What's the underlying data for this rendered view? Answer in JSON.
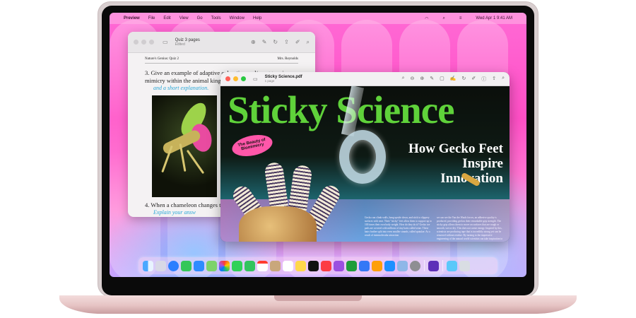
{
  "menubar": {
    "items": [
      "Preview",
      "File",
      "Edit",
      "View",
      "Go",
      "Tools",
      "Window",
      "Help"
    ],
    "clock": "Wed Apr 1  9:41 AM"
  },
  "window_quiz": {
    "title": "Quiz 3 pages",
    "subtitle": "Edited",
    "header_left": "Nature's Genius: Quiz 2",
    "header_right": "Mrs. Reynolds",
    "q3": "3. Give an example of adaptive coloration and/or aggressive mimicry within the animal king",
    "q3_hand": "and a short explanation.",
    "q4": "4. When a chameleon changes that an example of",
    "q4_hand": "Explain your answ"
  },
  "window_sticky": {
    "title": "Sticky Science.pdf",
    "subtitle": "1 page",
    "headline": "Sticky Science",
    "tagline": "How Gecko Feet Inspire Innovation",
    "badge": "The Beauty of Biomimicry",
    "body_col1": "Gecko can climb walls, hang upside down, and stick to slippery surfaces with ease. Their \"sticky\" feet allow them to support up to 100 times their own body weight. How do they do it? Gecko toe pads are covered with millions of tiny hairs called setae. These hairs further split into even smaller strands, called spatulae. As a result of intermolecular attraction",
    "body_col2": "we can see the Van der Waals forces, an adhesive quality is produced, providing geckos their remarkable grip strength. The sticky grip allows them to move on surfaces that are rough or smooth, wet or dry. This does not waste energy. Inspired by this, scientists are producing tape that is incredibly strong yet can be removed without residue. By turning to the impressive engineering of the natural world scientists can take inspiration to develop solutions to human problems."
  },
  "dock": {
    "apps": [
      "Finder",
      "Launchpad",
      "Safari",
      "Messages",
      "Mail",
      "Maps",
      "Photos",
      "FaceTime",
      "Phone",
      "Calendar",
      "Contacts",
      "Reminders",
      "Notes",
      "TV",
      "Music",
      "Podcasts",
      "Numbers",
      "Keynote",
      "Pages",
      "App Store",
      "Preview",
      "System Settings",
      "Screen Time",
      "Downloads",
      "Trash"
    ]
  },
  "colors": {
    "headline_green": "#5fd23a",
    "wallpaper_pink": "#ff4fc6",
    "chassis_pink": "#e6c4c4",
    "handwriting_blue": "#2aa7d6"
  }
}
